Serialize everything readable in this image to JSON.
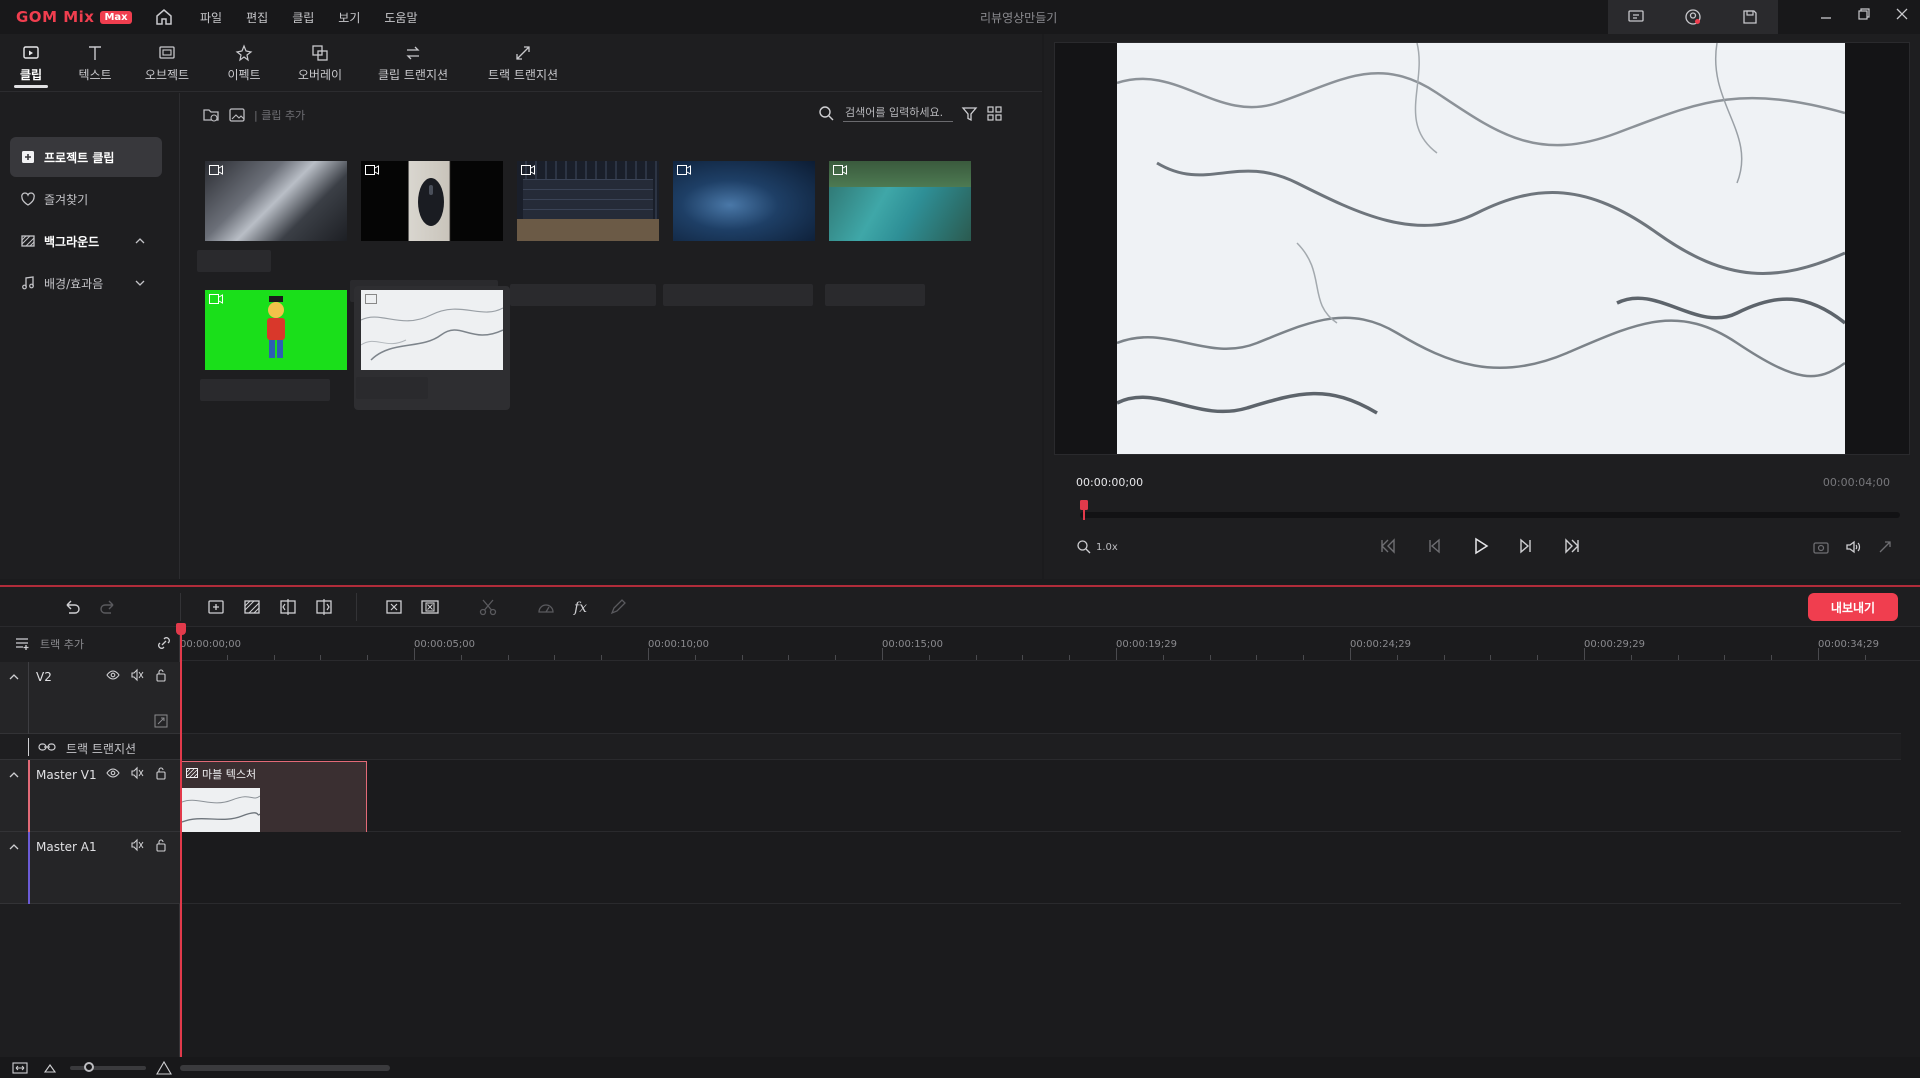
{
  "app": {
    "logo_text": "GOM Mix",
    "logo_badge": "Max",
    "window_title": "리뷰영상만들기",
    "menu": [
      "파일",
      "편집",
      "클립",
      "보기",
      "도움말"
    ]
  },
  "tabs": [
    {
      "label": "클립",
      "icon": "clip-icon",
      "active": true
    },
    {
      "label": "텍스트",
      "icon": "text-icon",
      "active": false
    },
    {
      "label": "오브젝트",
      "icon": "object-icon",
      "active": false
    },
    {
      "label": "이펙트",
      "icon": "effect-icon",
      "active": false
    },
    {
      "label": "오버레이",
      "icon": "overlay-icon",
      "active": false
    },
    {
      "label": "클립 트랜지션",
      "icon": "clip-transition-icon",
      "active": false
    },
    {
      "label": "트랙 트랜지션",
      "icon": "track-transition-icon",
      "active": false
    }
  ],
  "sidebar": {
    "items": [
      {
        "label": "프로젝트 클립",
        "icon": "add-clip-icon",
        "active": true
      },
      {
        "label": "즐겨찾기",
        "icon": "heart-icon"
      },
      {
        "label": "백그라운드",
        "icon": "background-icon",
        "expanded": true
      },
      {
        "label": "배경/효과음",
        "icon": "music-icon",
        "expanded": false
      }
    ]
  },
  "clip_panel": {
    "add_label": "| 클립 추가",
    "search_placeholder": "검색어를 입력하세요."
  },
  "preview": {
    "timecode_current": "00:00:00;00",
    "timecode_total": "00:00:04;00",
    "zoom": "1.0x",
    "progress": 0
  },
  "timeline": {
    "export_label": "내보내기",
    "add_track_label": "트랙 추가",
    "ruler_labels": [
      "00:00:00;00",
      "00:00:05;00",
      "00:00:10;00",
      "00:00:15;00",
      "00:00:19;29",
      "00:00:24;29",
      "00:00:29;29",
      "00:00:34;29"
    ],
    "tracks": {
      "v2": "V2",
      "transition": "트랙 트랜지션",
      "master_v1": "Master V1",
      "master_a1": "Master A1"
    },
    "clip_title": "마블 텍스처"
  },
  "colors": {
    "accent": "#f03e4f",
    "background": "#1b1b1d",
    "panel": "#1e1e20",
    "chroma_green": "#1adf1a"
  }
}
